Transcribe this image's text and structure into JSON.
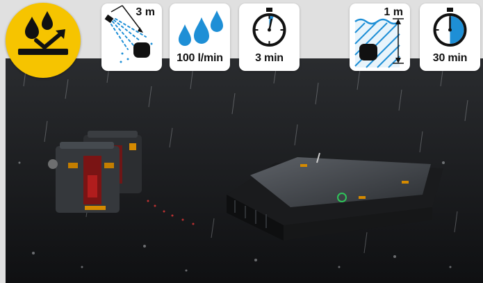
{
  "icons": {
    "waterproof_badge": "water-resistance-badge-icon",
    "spray_distance": {
      "icon": "spray-nozzle-icon",
      "label": "3 m"
    },
    "flow_rate": {
      "icon": "water-drops-icon",
      "label": "100 l/min"
    },
    "spray_duration": {
      "icon": "stopwatch-icon",
      "label": "3 min"
    },
    "immersion_depth": {
      "icon": "immersion-depth-icon",
      "label": "1 m"
    },
    "immersion_duration": {
      "icon": "stopwatch-icon",
      "label": "30 min"
    }
  },
  "colors": {
    "badge_yellow": "#f6c400",
    "water_blue": "#1e8fd6",
    "tile_background": "#ffffff",
    "frame_gray": "#e0e0e0"
  }
}
